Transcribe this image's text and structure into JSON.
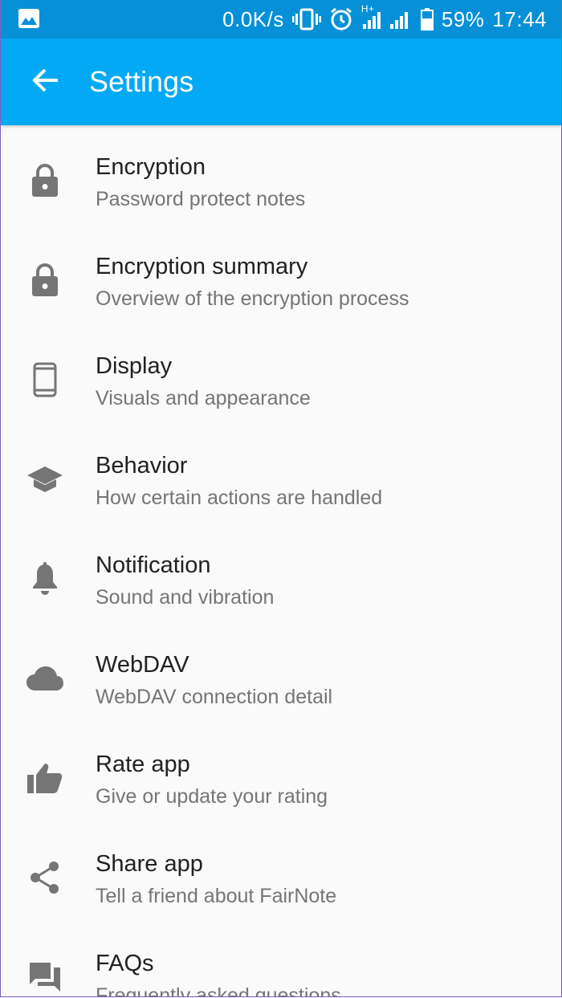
{
  "status_bar": {
    "network_speed": "0.0K/s",
    "battery_percent": "59%",
    "time": "17:44",
    "network_type": "H+",
    "icons": [
      "image-icon",
      "vibrate-icon",
      "alarm-icon",
      "signal-icon",
      "battery-icon"
    ]
  },
  "app_bar": {
    "title": "Settings",
    "back_icon": "arrow-back-icon"
  },
  "colors": {
    "status_bar": "#0590d7",
    "app_bar": "#03a9f4",
    "background": "#fafafa",
    "icon": "#757575"
  },
  "settings": [
    {
      "title": "Encryption",
      "summary": "Password protect notes",
      "icon": "lock-icon"
    },
    {
      "title": "Encryption summary",
      "summary": "Overview of the encryption process",
      "icon": "lock-icon"
    },
    {
      "title": "Display",
      "summary": "Visuals and appearance",
      "icon": "smartphone-icon"
    },
    {
      "title": "Behavior",
      "summary": "How certain actions are handled",
      "icon": "school-icon"
    },
    {
      "title": "Notification",
      "summary": "Sound and vibration",
      "icon": "bell-icon"
    },
    {
      "title": "WebDAV",
      "summary": "WebDAV connection detail",
      "icon": "cloud-icon"
    },
    {
      "title": "Rate app",
      "summary": "Give or update your rating",
      "icon": "thumb-up-icon"
    },
    {
      "title": "Share app",
      "summary": "Tell a friend about FairNote",
      "icon": "share-icon"
    },
    {
      "title": "FAQs",
      "summary": "Frequently asked questions",
      "icon": "forum-icon"
    }
  ]
}
